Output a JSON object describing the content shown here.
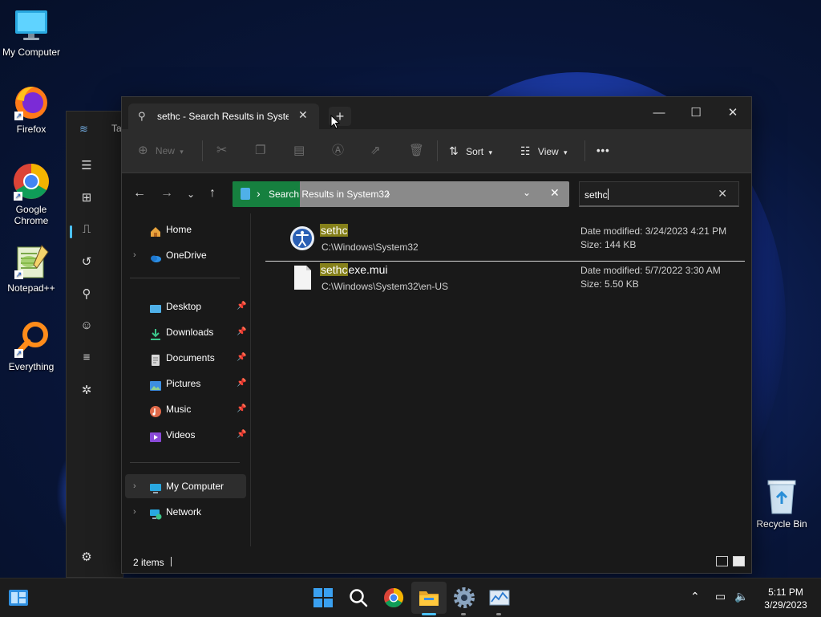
{
  "desktop": {
    "icons": [
      {
        "label": "My Computer"
      },
      {
        "label": "Firefox"
      },
      {
        "label": "Google Chrome"
      },
      {
        "label": "Notepad++"
      },
      {
        "label": "Everything"
      },
      {
        "label": "Recycle Bin"
      }
    ],
    "background_window": {
      "title_fragment": "Ta"
    }
  },
  "explorer": {
    "tab_title": "sethc - Search Results in Syste",
    "new_tab_symbol": "+",
    "window_buttons": {
      "minimize": "—",
      "maximize": "☐",
      "close": "✕"
    },
    "toolbar": {
      "new_label": "New",
      "sort_label": "Sort",
      "view_label": "View",
      "more_label": "•••"
    },
    "address": {
      "path_label": "Search Results in System32",
      "progress_percent": 20
    },
    "search": {
      "value": "sethc"
    },
    "sidebar": {
      "top": [
        {
          "label": "Home"
        },
        {
          "label": "OneDrive"
        }
      ],
      "quick": [
        {
          "label": "Desktop"
        },
        {
          "label": "Downloads"
        },
        {
          "label": "Documents"
        },
        {
          "label": "Pictures"
        },
        {
          "label": "Music"
        },
        {
          "label": "Videos"
        }
      ],
      "bottom": [
        {
          "label": "My Computer"
        },
        {
          "label": "Network"
        }
      ]
    },
    "results": [
      {
        "name_highlight": "sethc",
        "name_rest": "",
        "path": "C:\\Windows\\System32",
        "date_modified": "Date modified: 3/24/2023 4:21 PM",
        "size": "Size: 144 KB"
      },
      {
        "name_highlight": "sethc",
        "name_rest": "exe.mui",
        "path": "C:\\Windows\\System32\\en-US",
        "date_modified": "Date modified: 5/7/2022 3:30 AM",
        "size": "Size: 5.50 KB"
      }
    ],
    "status": {
      "item_count": "2 items"
    }
  },
  "taskbar": {
    "clock": {
      "time": "5:11 PM",
      "date": "3/29/2023"
    }
  },
  "colors": {
    "accent_green": "#16803f",
    "highlight": "#85801a",
    "taskbar_accent": "#4cc2ff"
  }
}
